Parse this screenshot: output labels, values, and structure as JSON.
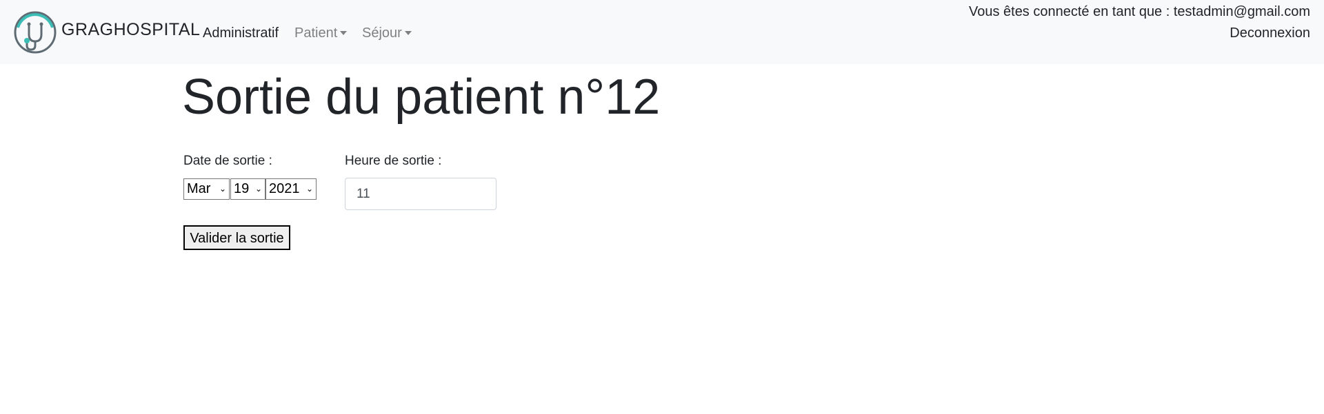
{
  "navbar": {
    "brand": "GRAGHOSPITAL",
    "links": {
      "administratif": "Administratif",
      "patient": "Patient",
      "sejour": "Séjour"
    },
    "user_info": "Vous êtes connecté en tant que : testadmin@gmail.com",
    "logout": "Deconnexion"
  },
  "page": {
    "title": "Sortie du patient n°12"
  },
  "form": {
    "date_label": "Date de sortie :",
    "month": "Mar",
    "day": "19",
    "year": "2021",
    "heure_label": "Heure de sortie :",
    "heure_value": "11",
    "submit_label": "Valider la sortie"
  },
  "colors": {
    "navbar_bg": "#f8f9fa",
    "nav_muted": "#808080",
    "logo_teal": "#3bbdb6",
    "logo_gray": "#5f6b73"
  },
  "icons": {
    "logo": "stethoscope-logo-icon",
    "dropdown": "caret-down-icon",
    "select": "chevron-down-icon"
  }
}
